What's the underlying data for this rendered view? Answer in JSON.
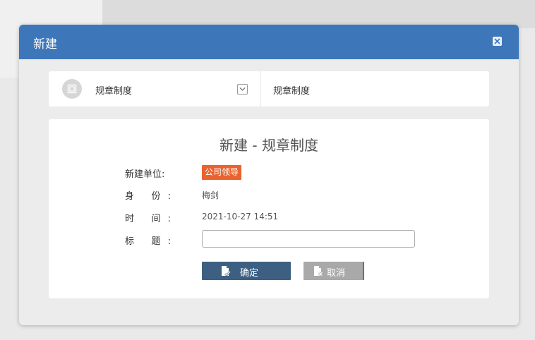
{
  "dialog": {
    "title": "新建"
  },
  "selector": {
    "category_label": "规章制度",
    "selected_value": "规章制度"
  },
  "form": {
    "heading": "新建 - 规章制度",
    "fields": {
      "unit": {
        "label": "新建单位:",
        "value": "公司领导"
      },
      "identity": {
        "label": "身 份:",
        "value": "梅剑"
      },
      "time": {
        "label": "时 间:",
        "value": "2021-10-27 14:51"
      },
      "title": {
        "label": "标 题:",
        "value": ""
      }
    },
    "buttons": {
      "confirm": "确定",
      "cancel": "取消"
    }
  },
  "colors": {
    "header": "#3d77ba",
    "badge": "#e8632e",
    "confirm_button": "#3d5f82",
    "cancel_button": "#a9a9a9"
  },
  "icons": {
    "close": "close-icon",
    "document": "document-icon",
    "dropdown": "chevron-down-icon",
    "confirm": "file-check-icon",
    "cancel": "file-cancel-icon"
  }
}
